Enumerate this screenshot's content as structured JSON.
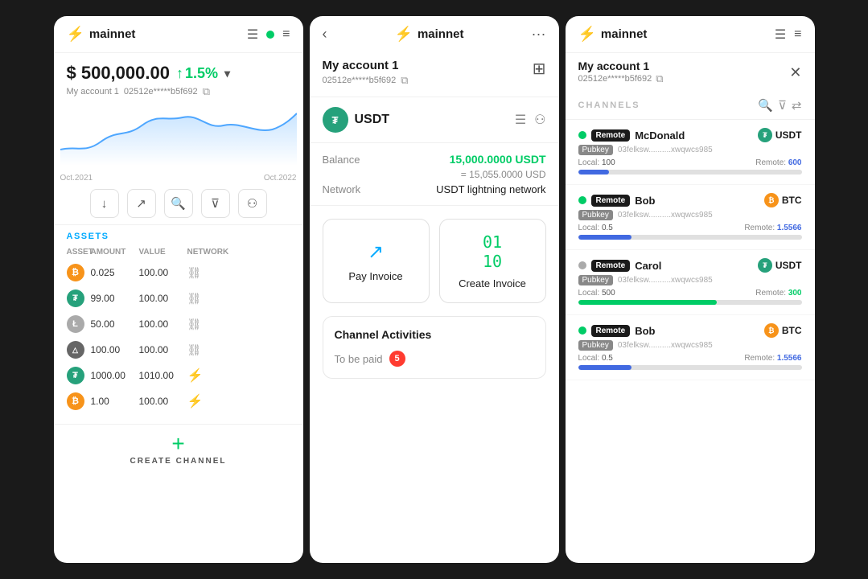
{
  "panel1": {
    "logo": "mainnet",
    "balance": "$ 500,000.00",
    "change": "1.5%",
    "account_label": "My account 1",
    "account_id": "02512e*****b5f692",
    "chart_date_start": "Oct.2021",
    "chart_date_end": "Oct.2022",
    "assets_label": "ASSETS",
    "col_headers": [
      "ASSET",
      "AMOUNT",
      "VALUE",
      "NETWORK"
    ],
    "assets": [
      {
        "type": "btc",
        "symbol": "B",
        "amount": "0.025",
        "value": "100.00",
        "network": "chain"
      },
      {
        "type": "usdt",
        "symbol": "T",
        "amount": "99.00",
        "value": "100.00",
        "network": "chain"
      },
      {
        "type": "ltc",
        "symbol": "L",
        "amount": "50.00",
        "value": "100.00",
        "network": "chain"
      },
      {
        "type": "generic",
        "symbol": "△",
        "amount": "100.00",
        "value": "100.00",
        "network": "chain"
      },
      {
        "type": "usdt",
        "symbol": "T",
        "amount": "1000.00",
        "value": "1010.00",
        "network": "lightning"
      },
      {
        "type": "btc",
        "symbol": "B",
        "amount": "1.00",
        "value": "100.00",
        "network": "lightning"
      }
    ],
    "create_channel_label": "CREATE CHANNEL"
  },
  "panel2": {
    "logo": "mainnet",
    "account_name": "My account 1",
    "account_id": "02512e*****b5f692",
    "token_name": "USDT",
    "balance_label": "Balance",
    "balance_value": "15,000.0000 USDT",
    "balance_usd": "= 15,055.0000 USD",
    "network_label": "Network",
    "network_value": "USDT lightning network",
    "pay_invoice_label": "Pay Invoice",
    "create_invoice_label": "Create Invoice",
    "channel_activities_title": "Channel Activities",
    "to_be_paid_label": "To be paid",
    "to_be_paid_count": "5"
  },
  "panel3": {
    "logo": "mainnet",
    "account_name": "My account 1",
    "account_id": "02512e*****b5f692",
    "channels_label": "CHANNELS",
    "channels": [
      {
        "status": "green",
        "name": "McDonald",
        "token": "USDT",
        "token_type": "usdt",
        "pubkey": "03felksw..........xwqwcs985",
        "local_label": "Local:",
        "local_val": "100",
        "remote_label": "Remote:",
        "remote_val": "600",
        "bar_pct": 14,
        "bar_color": "blue"
      },
      {
        "status": "green",
        "name": "Bob",
        "token": "BTC",
        "token_type": "btc",
        "pubkey": "03felksw..........xwqwcs985",
        "local_label": "Local:",
        "local_val": "0.5",
        "remote_label": "Remote:",
        "remote_val": "1.5566",
        "bar_pct": 24,
        "bar_color": "blue"
      },
      {
        "status": "gray",
        "name": "Carol",
        "token": "USDT",
        "token_type": "usdt",
        "pubkey": "03felksw..........xwqwcs985",
        "local_label": "Local:",
        "local_val": "500",
        "remote_label": "Remote:",
        "remote_val": "300",
        "bar_pct": 62,
        "bar_color": "green"
      },
      {
        "status": "green",
        "name": "Bob",
        "token": "BTC",
        "token_type": "btc",
        "pubkey": "03felksw..........xwqwcs985",
        "local_label": "Local:",
        "local_val": "0.5",
        "remote_label": "Remote:",
        "remote_val": "1.5566",
        "bar_pct": 24,
        "bar_color": "blue"
      }
    ]
  }
}
